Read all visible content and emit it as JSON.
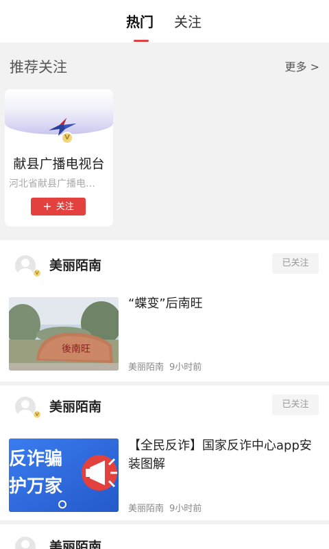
{
  "tabs": [
    {
      "label": "热门",
      "active": true
    },
    {
      "label": "关注",
      "active": false
    }
  ],
  "recommend": {
    "title": "推荐关注",
    "more": "更多 >",
    "card": {
      "name": "献县广播电视台",
      "description": "河北省献县广播电…",
      "follow_label": "关注",
      "verified_badge": "V"
    }
  },
  "posts": [
    {
      "author": "美丽陌南",
      "follow_status": "已关注",
      "title": "“蝶变”后南旺",
      "image_text": "後南旺",
      "source": "美丽陌南",
      "time": "9小时前"
    },
    {
      "author": "美丽陌南",
      "follow_status": "已关注",
      "title": "【全民反诈】国家反诈中心app安装图解",
      "image_text_line1": "反诈骗",
      "image_text_line2": "护万家",
      "source": "美丽陌南",
      "time": "9小时前"
    },
    {
      "author": "美丽陌南"
    }
  ],
  "colors": {
    "accent": "#e2413e",
    "background": "#f2f2f2"
  }
}
